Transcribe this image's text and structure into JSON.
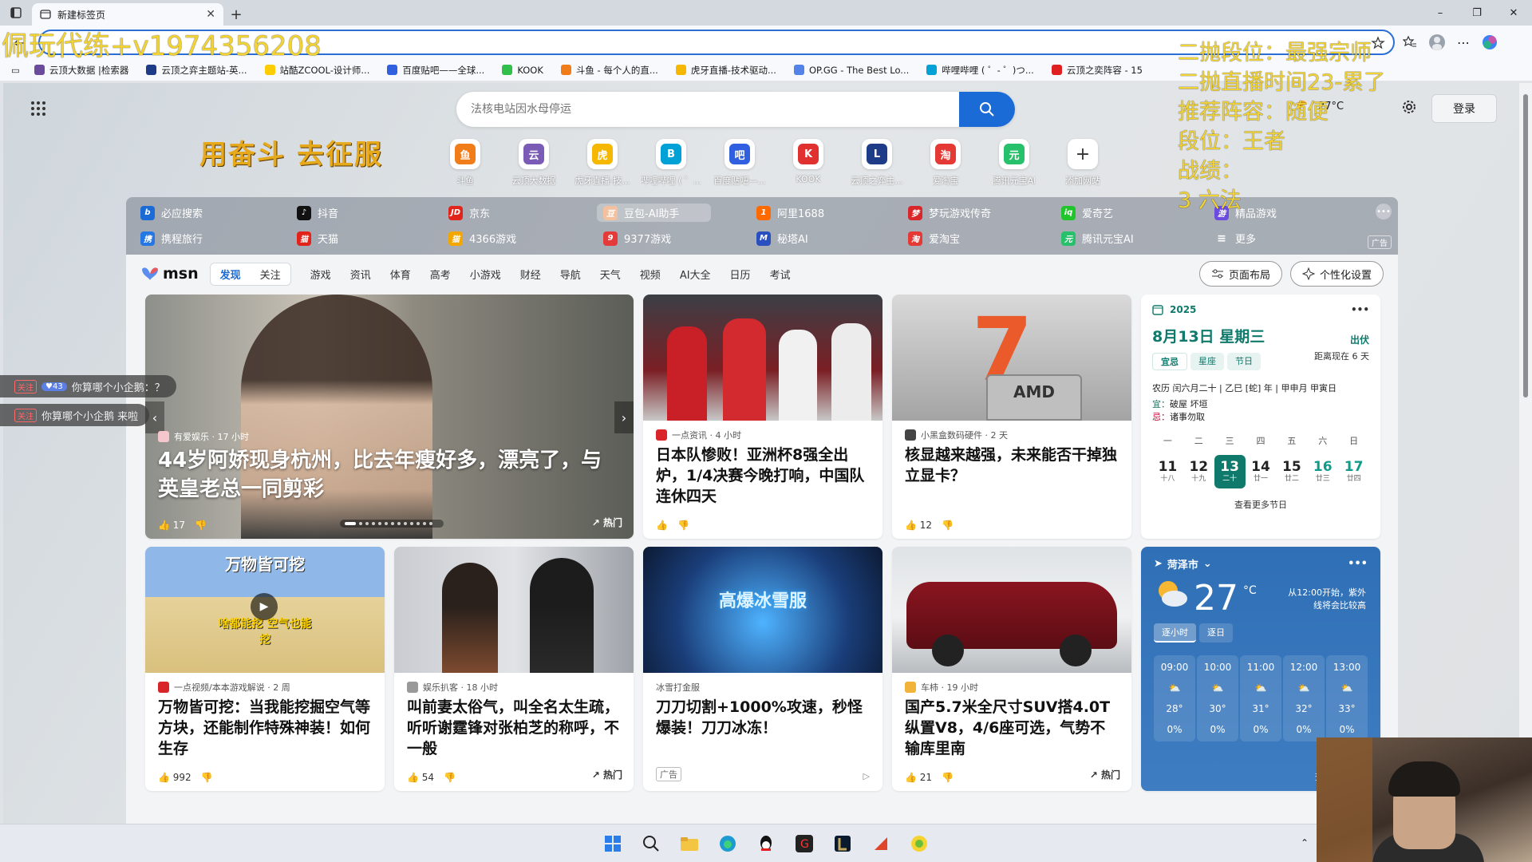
{
  "browser": {
    "tab_title": "新建标签页",
    "new_tab": "+",
    "controls": {
      "minimize": "–",
      "restore": "❐",
      "close": "✕"
    }
  },
  "overlay": {
    "left_text": "佩玩代练+v1974356208",
    "right_lines": [
      "二抛段位：最强宗师",
      "二抛直播时间23-累了",
      "推荐阵容：随便",
      "段位：王者",
      "战绩：",
      "3 六法"
    ]
  },
  "bookmarks": [
    {
      "label": "云顶大数据 |检索器",
      "color": "#6a4b9c"
    },
    {
      "label": "云顶之弈主题站-英...",
      "color": "#1f3c88"
    },
    {
      "label": "站酷ZCOOL-设计师...",
      "color": "#ffcc00"
    },
    {
      "label": "百度贴吧——全球...",
      "color": "#3060e0"
    },
    {
      "label": "KOOK",
      "color": "#2fbf4a"
    },
    {
      "label": "斗鱼 - 每个人的直...",
      "color": "#f07c1a"
    },
    {
      "label": "虎牙直播-技术驱动...",
      "color": "#f5b700"
    },
    {
      "label": "OP.GG - The Best Lo...",
      "color": "#5383e8"
    },
    {
      "label": "哔哩哔哩 ( ゜- ゜)つ...",
      "color": "#00a1d6"
    },
    {
      "label": "云顶之奕阵容 - 15",
      "color": "#e02020"
    }
  ],
  "search": {
    "placeholder": "法核电站因水母停运"
  },
  "header": {
    "weather_text": "27°C",
    "login": "登录",
    "slogan": "用奋斗 去征服"
  },
  "quick_links": [
    {
      "label": "斗鱼",
      "bg": "#f07c1a",
      "g": "鱼"
    },
    {
      "label": "云顶大数据",
      "bg": "#7a5bb5",
      "g": "云"
    },
    {
      "label": "虎牙直播-技...",
      "bg": "#f5b700",
      "g": "虎"
    },
    {
      "label": "哔哩哔哩 ( ゜...",
      "bg": "#00a1d6",
      "g": "B"
    },
    {
      "label": "百度贴吧—...",
      "bg": "#3060e0",
      "g": "吧"
    },
    {
      "label": "KOOK",
      "bg": "#e03030",
      "g": "K"
    },
    {
      "label": "云顶之弈主...",
      "bg": "#1f3c88",
      "g": "L"
    },
    {
      "label": "爱淘宝",
      "bg": "#e53935",
      "g": "淘"
    },
    {
      "label": "腾讯元宝AI",
      "bg": "#27c06b",
      "g": "元"
    },
    {
      "label": "添加网站",
      "bg": "#ffffff",
      "g": "+"
    }
  ],
  "links_row1": [
    {
      "label": "必应搜索",
      "bg": "#1a6bd6",
      "g": "b"
    },
    {
      "label": "抖音",
      "bg": "#111111",
      "g": "♪"
    },
    {
      "label": "京东",
      "bg": "#e1251b",
      "g": "JD"
    },
    {
      "label": "豆包-AI助手",
      "bg": "#f3c1a0",
      "g": "豆"
    },
    {
      "label": "阿里1688",
      "bg": "#ff6a00",
      "g": "1"
    },
    {
      "label": "梦玩游戏传奇",
      "bg": "#d8262a",
      "g": "梦"
    },
    {
      "label": "爱奇艺",
      "bg": "#20c42b",
      "g": "iq"
    },
    {
      "label": "精品游戏",
      "bg": "#6c4ce0",
      "g": "游"
    }
  ],
  "links_row2": [
    {
      "label": "携程旅行",
      "bg": "#2577e3",
      "g": "携"
    },
    {
      "label": "天猫",
      "bg": "#e2231a",
      "g": "猫"
    },
    {
      "label": "4366游戏",
      "bg": "#f3a600",
      "g": "猫"
    },
    {
      "label": "9377游戏",
      "bg": "#e43a3a",
      "g": "9"
    },
    {
      "label": "秘塔AI",
      "bg": "#2a4fbf",
      "g": "M"
    },
    {
      "label": "爱淘宝",
      "bg": "#e53935",
      "g": "淘"
    },
    {
      "label": "腾讯元宝AI",
      "bg": "#27c06b",
      "g": "元"
    },
    {
      "label": "更多",
      "bg": "transparent",
      "g": "≡"
    }
  ],
  "links_ad": "广告",
  "feed": {
    "logo": "msn",
    "tabs": [
      "发现",
      "关注",
      "游戏",
      "资讯",
      "体育",
      "高考",
      "小游戏",
      "财经",
      "导航",
      "天气",
      "视频",
      "AI大全",
      "日历",
      "考试"
    ],
    "layout_btn": "页面布局",
    "personalize_btn": "个性化设置"
  },
  "cards": {
    "hero": {
      "source": "有爱娱乐 · 17 小时",
      "title": "44岁阿娇现身杭州，比去年瘦好多，漂亮了，与英皇老总一同剪彩",
      "likes": "17",
      "hot": "热门"
    },
    "c2": {
      "source": "一点资讯 · 4 小时",
      "title": "日本队惨败！亚洲杯8强全出炉，1/4决赛今晚打响，中国队连休四天"
    },
    "c3": {
      "source": "小黑盒数码硬件 · 2 天",
      "title": "核显越来越强，未来能否干掉独立显卡？",
      "likes": "12"
    },
    "c4": {
      "source": "一点视频/本本游戏解说 · 2 周",
      "title": "万物皆可挖：当我能挖掘空气等方块，还能制作特殊神装！如何生存",
      "likes": "992",
      "img_text": "万物皆可挖",
      "img_sub": "啥都能挖 空气也能挖"
    },
    "c5": {
      "source": "娱乐扒客 · 18 小时",
      "title": "叫前妻太俗气，叫全名太生疏，听听谢霆锋对张柏芝的称呼，不一般",
      "likes": "54",
      "hot": "热门"
    },
    "c6": {
      "source": "冰雪打金服",
      "title": "刀刀切割+1000%攻速，秒怪爆装！刀刀冰冻！",
      "ad": "广告",
      "img_text": "高爆冰雪服"
    },
    "c7": {
      "source": "车柿 · 19 小时",
      "title": "国产5.7米全尺寸SUV搭4.0T纵置V8，4/6座可选，气势不输库里南",
      "likes": "21",
      "hot": "热门"
    }
  },
  "calendar": {
    "year": "2025",
    "date": "8月13日 星期三",
    "term": "出伏",
    "term_sub": "距离现在 6 天",
    "tabs": [
      "宜忌",
      "星座",
      "节日"
    ],
    "lunar": "农历 闰六月二十 | 乙巳 [蛇] 年 | 甲申月 甲寅日",
    "yi_label": "宜：",
    "yi": "破屋 坏垣",
    "ji_label": "忌：",
    "ji": "诸事勿取",
    "weekdays": [
      "一",
      "二",
      "三",
      "四",
      "五",
      "六",
      "日"
    ],
    "days": [
      {
        "d": "11",
        "l": "十八"
      },
      {
        "d": "12",
        "l": "十九"
      },
      {
        "d": "13",
        "l": "二十"
      },
      {
        "d": "14",
        "l": "廿一"
      },
      {
        "d": "15",
        "l": "廿二"
      },
      {
        "d": "16",
        "l": "廿三"
      },
      {
        "d": "17",
        "l": "廿四"
      }
    ],
    "more": "查看更多节日"
  },
  "weather": {
    "city": "菏泽市",
    "temp": "27",
    "unit": "°C",
    "note_line1": "从12:00开始，紫外",
    "note_line2": "线将会比较高",
    "tabs": [
      "逐小时",
      "逐日"
    ],
    "hours": [
      {
        "t": "09:00",
        "temp": "28°",
        "rain": "0%"
      },
      {
        "t": "10:00",
        "temp": "30°",
        "rain": "0%"
      },
      {
        "t": "11:00",
        "temp": "31°",
        "rain": "0%"
      },
      {
        "t": "12:00",
        "temp": "32°",
        "rain": "0%"
      },
      {
        "t": "13:00",
        "temp": "33°",
        "rain": "0%"
      }
    ],
    "more": "查看"
  },
  "danmu": [
    {
      "tag": "关注",
      "lv": "43",
      "text": "你算哪个小企鹅：？"
    },
    {
      "tag": "关注",
      "text": "你算哪个小企鹅  来啦"
    }
  ]
}
